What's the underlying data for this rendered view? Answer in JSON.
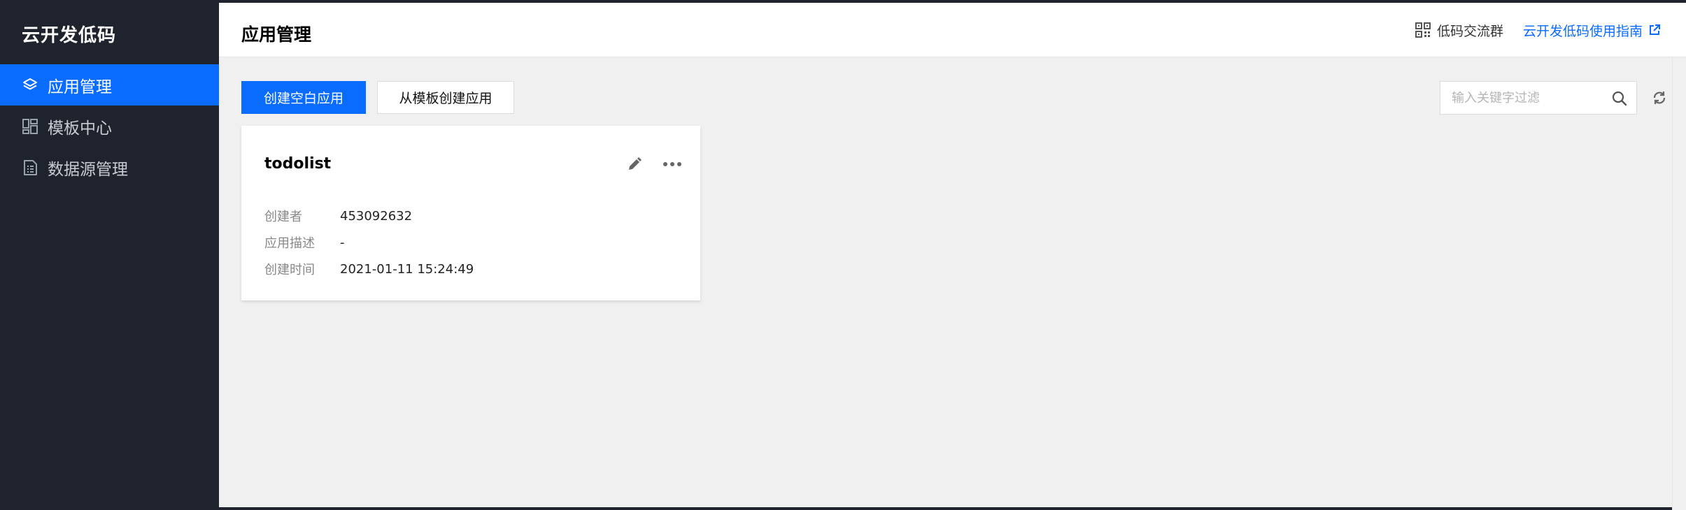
{
  "sidebar": {
    "brand": "云开发低码",
    "items": [
      {
        "label": "应用管理",
        "icon": "layers-icon",
        "active": true
      },
      {
        "label": "模板中心",
        "icon": "dashboard-icon",
        "active": false
      },
      {
        "label": "数据源管理",
        "icon": "list-doc-icon",
        "active": false
      }
    ]
  },
  "header": {
    "title": "应用管理",
    "qr_label": "低码交流群",
    "guide_label": "云开发低码使用指南"
  },
  "toolbar": {
    "create_blank": "创建空白应用",
    "create_from_template": "从模板创建应用",
    "search_placeholder": "输入关键字过滤"
  },
  "apps": [
    {
      "name": "todolist",
      "fields": [
        {
          "label": "创建者",
          "value": "453092632"
        },
        {
          "label": "应用描述",
          "value": "-"
        },
        {
          "label": "创建时间",
          "value": "2021-01-11 15:24:49"
        }
      ]
    }
  ],
  "colors": {
    "sidebar_bg": "#1f232d",
    "accent": "#0a6cff",
    "content_bg": "#f0f0f0"
  }
}
